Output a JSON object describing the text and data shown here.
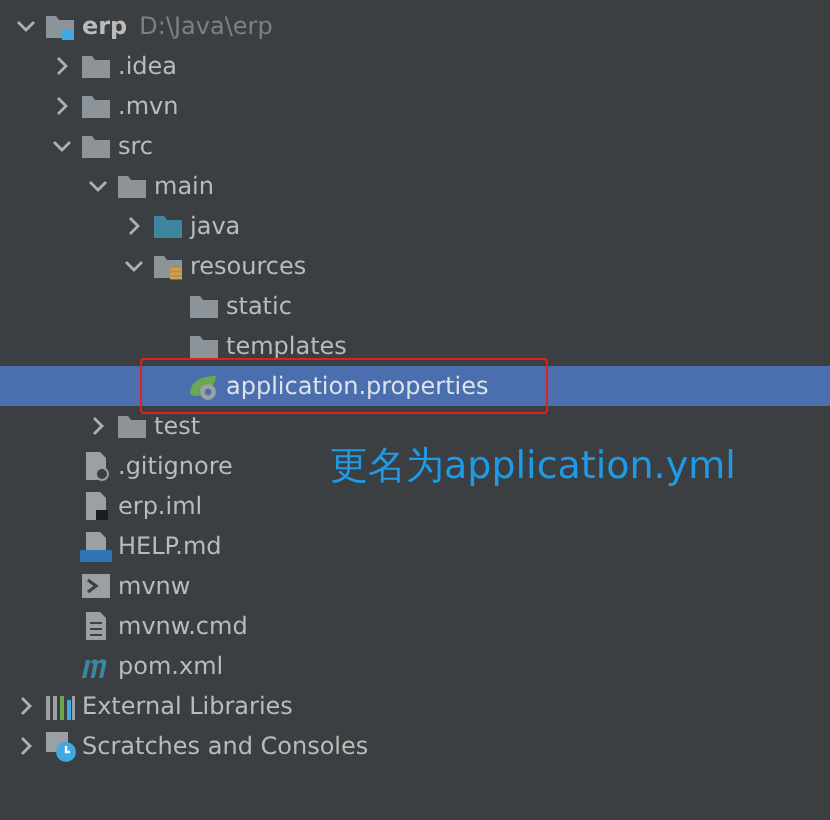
{
  "tree": [
    {
      "name": "erp",
      "kind": "project",
      "hint": "D:\\Java\\erp",
      "expanded": true,
      "selected": false,
      "children": [
        {
          "name": ".idea",
          "kind": "folder",
          "expanded": false,
          "selected": false
        },
        {
          "name": ".mvn",
          "kind": "folder",
          "expanded": false,
          "selected": false
        },
        {
          "name": "src",
          "kind": "folder",
          "expanded": true,
          "selected": false,
          "children": [
            {
              "name": "main",
              "kind": "folder",
              "expanded": true,
              "selected": false,
              "children": [
                {
                  "name": "java",
                  "kind": "source",
                  "expanded": false,
                  "selected": false
                },
                {
                  "name": "resources",
                  "kind": "resources",
                  "expanded": true,
                  "selected": false,
                  "children": [
                    {
                      "name": "static",
                      "kind": "folder",
                      "selected": false
                    },
                    {
                      "name": "templates",
                      "kind": "folder",
                      "selected": false
                    },
                    {
                      "name": "application.properties",
                      "kind": "properties",
                      "selected": true,
                      "marked": true
                    }
                  ]
                }
              ]
            },
            {
              "name": "test",
              "kind": "folder",
              "expanded": false,
              "selected": false
            }
          ]
        },
        {
          "name": ".gitignore",
          "kind": "gitignore",
          "selected": false
        },
        {
          "name": "erp.iml",
          "kind": "iml",
          "selected": false
        },
        {
          "name": "HELP.md",
          "kind": "markdown",
          "selected": false
        },
        {
          "name": "mvnw",
          "kind": "script",
          "selected": false
        },
        {
          "name": "mvnw.cmd",
          "kind": "text",
          "selected": false
        },
        {
          "name": "pom.xml",
          "kind": "maven",
          "selected": false
        }
      ]
    },
    {
      "name": "External Libraries",
      "kind": "libraries",
      "expanded": false,
      "selected": false
    },
    {
      "name": "Scratches and Consoles",
      "kind": "scratches",
      "expanded": false,
      "selected": false
    }
  ],
  "annotation": {
    "text": "更名为application.yml"
  }
}
